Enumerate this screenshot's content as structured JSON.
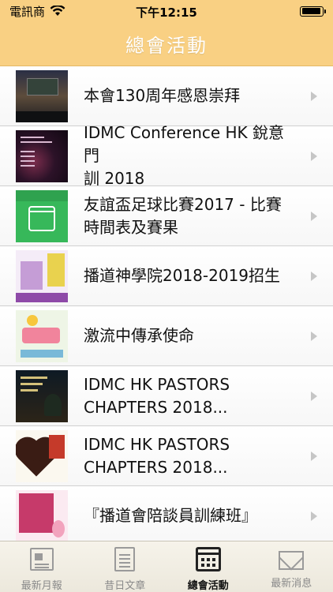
{
  "status": {
    "carrier": "電訊商",
    "time": "下午12:15",
    "battery_level": 0.95
  },
  "nav": {
    "title": "總會活動"
  },
  "items": [
    {
      "title": "本會130周年感恩崇拜",
      "thumb_icon": "stage-screen-photo"
    },
    {
      "title": "IDMC Conference HK 銳意門\n訓 2018",
      "thumb_icon": "conference-poster"
    },
    {
      "title": "友誼盃足球比賽2017 - 比賽\n時間表及賽果",
      "thumb_icon": "calendar-icon"
    },
    {
      "title": "播道神學院2018-2019招生",
      "thumb_icon": "seminary-poster"
    },
    {
      "title": "激流中傳承使命",
      "thumb_icon": "mission-poster"
    },
    {
      "title": "IDMC HK PASTORS\nCHAPTERS 2018...",
      "thumb_icon": "pastors-poster"
    },
    {
      "title": "IDMC HK PASTORS\nCHAPTERS 2018...",
      "thumb_icon": "heart-poster"
    },
    {
      "title": "『播道會陪談員訓練班』",
      "thumb_icon": "training-poster"
    }
  ],
  "tabs": [
    {
      "label": "最新月報",
      "icon": "newspaper-icon",
      "active": false
    },
    {
      "label": "昔日文章",
      "icon": "document-icon",
      "active": false
    },
    {
      "label": "總會活動",
      "icon": "calendar-icon",
      "active": true
    },
    {
      "label": "最新消息",
      "icon": "mail-icon",
      "active": false
    }
  ],
  "colors": {
    "header": "#f9d083",
    "header_title": "#ffffff",
    "tab_active": "#111111",
    "tab_inactive": "#8a8a8a"
  }
}
